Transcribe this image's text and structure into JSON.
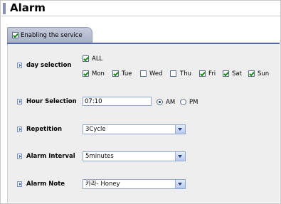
{
  "page": {
    "title": "Alarm"
  },
  "tab": {
    "label": "Enabling the service",
    "checked": true
  },
  "day_selection": {
    "label": "day selection",
    "all": {
      "label": "ALL",
      "checked": true
    },
    "days": [
      {
        "label": "Mon",
        "checked": true
      },
      {
        "label": "Tue",
        "checked": true
      },
      {
        "label": "Wed",
        "checked": false
      },
      {
        "label": "Thu",
        "checked": false
      },
      {
        "label": "Fri",
        "checked": true
      },
      {
        "label": "Sat",
        "checked": true
      },
      {
        "label": "Sun",
        "checked": true
      }
    ]
  },
  "hour_selection": {
    "label": "Hour Selection",
    "value": "07:10",
    "am_label": "AM",
    "pm_label": "PM",
    "selected": "AM"
  },
  "repetition": {
    "label": "Repetition",
    "value": "3Cycle"
  },
  "alarm_interval": {
    "label": "Alarm Interval",
    "value": "5minutes"
  },
  "alarm_note": {
    "label": "Alarm Note",
    "value": "카라- Honey"
  },
  "colors": {
    "tab_accent": "#5367a6",
    "panel_bg": "#eeeeee",
    "check_green": "#1a8a1a"
  }
}
